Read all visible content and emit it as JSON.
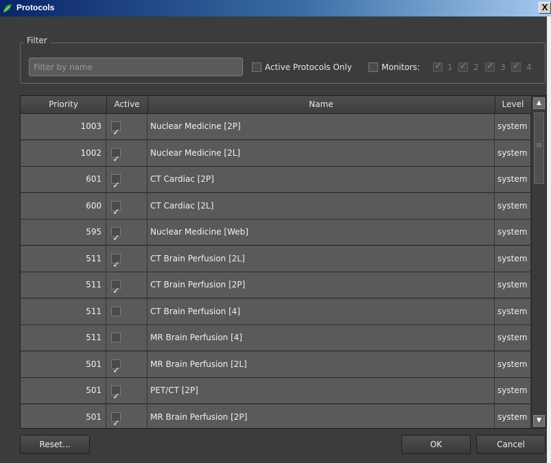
{
  "window": {
    "title": "Protocols",
    "close_glyph": "X",
    "icon": "app-leaf-icon"
  },
  "filter": {
    "legend": "Filter",
    "placeholder": "Filter by name",
    "value": "",
    "active_only_label": "Active Protocols Only",
    "active_only_checked": false,
    "monitors_label": "Monitors:",
    "monitors_checked": false,
    "monitors": [
      {
        "label": "1",
        "checked": true
      },
      {
        "label": "2",
        "checked": true
      },
      {
        "label": "3",
        "checked": true
      },
      {
        "label": "4",
        "checked": true
      }
    ]
  },
  "table": {
    "columns": [
      "Priority",
      "Active",
      "Name",
      "Level"
    ],
    "rows": [
      {
        "priority": "1003",
        "active": true,
        "name": "Nuclear Medicine [2P]",
        "level": "system"
      },
      {
        "priority": "1002",
        "active": true,
        "name": "Nuclear Medicine [2L]",
        "level": "system"
      },
      {
        "priority": "601",
        "active": true,
        "name": "CT Cardiac [2P]",
        "level": "system"
      },
      {
        "priority": "600",
        "active": true,
        "name": "CT Cardiac [2L]",
        "level": "system"
      },
      {
        "priority": "595",
        "active": true,
        "name": "Nuclear Medicine [Web]",
        "level": "system"
      },
      {
        "priority": "511",
        "active": true,
        "name": "CT Brain Perfusion [2L]",
        "level": "system"
      },
      {
        "priority": "511",
        "active": true,
        "name": "CT Brain Perfusion [2P]",
        "level": "system"
      },
      {
        "priority": "511",
        "active": false,
        "name": "CT Brain Perfusion [4]",
        "level": "system"
      },
      {
        "priority": "511",
        "active": false,
        "name": "MR Brain Perfusion [4]",
        "level": "system"
      },
      {
        "priority": "501",
        "active": true,
        "name": "MR Brain Perfusion [2L]",
        "level": "system"
      },
      {
        "priority": "501",
        "active": true,
        "name": "PET/CT [2P]",
        "level": "system"
      },
      {
        "priority": "501",
        "active": true,
        "name": "MR Brain Perfusion [2P]",
        "level": "system"
      }
    ]
  },
  "buttons": {
    "reset": "Reset...",
    "ok": "OK",
    "cancel": "Cancel"
  },
  "colors": {
    "background": "#3c3c3c",
    "row": "#5a5a5a",
    "titlebar": "#0a246a"
  }
}
